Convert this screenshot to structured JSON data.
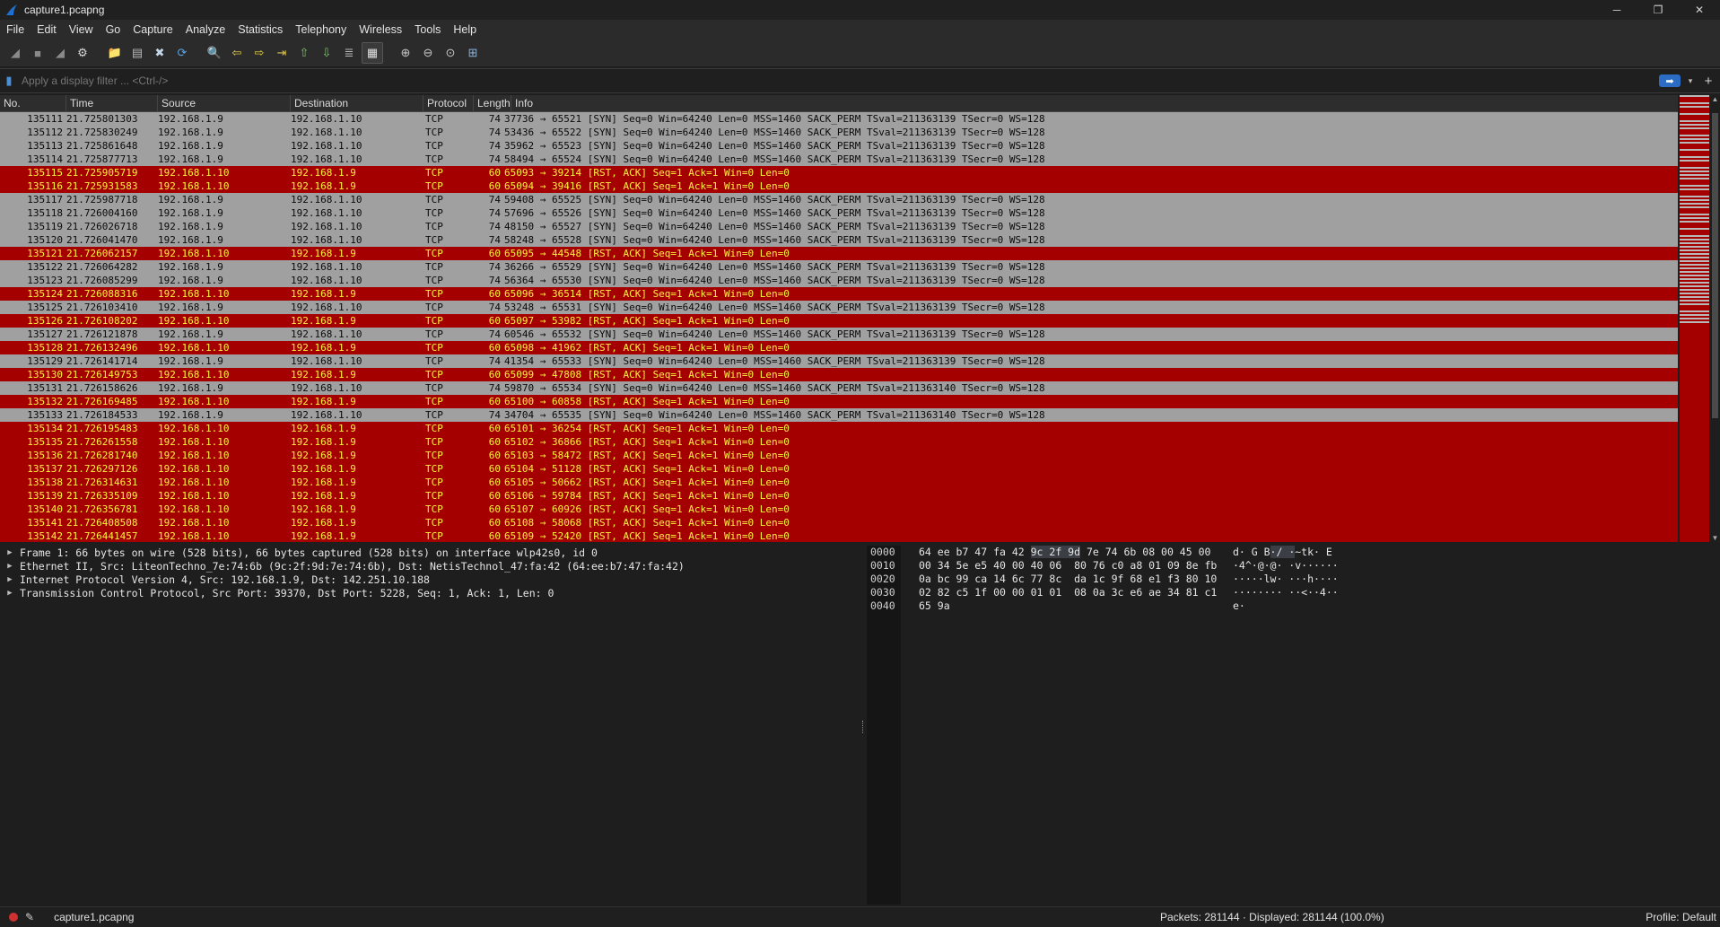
{
  "window": {
    "title": "capture1.pcapng",
    "minimize": "─",
    "maximize": "❐",
    "close": "✕"
  },
  "menu": [
    "File",
    "Edit",
    "View",
    "Go",
    "Capture",
    "Analyze",
    "Statistics",
    "Telephony",
    "Wireless",
    "Tools",
    "Help"
  ],
  "toolbar": {
    "icons": [
      "shark-fin-start-icon",
      "stop-square-icon",
      "restart-fin-icon",
      "capture-options-gear-icon",
      "open-folder-icon",
      "save-file-icon",
      "close-file-icon",
      "reload-icon",
      "find-packet-icon",
      "go-back-arrow-icon",
      "go-forward-arrow-icon",
      "go-to-packet-icon",
      "first-packet-arrow-icon",
      "last-packet-arrow-icon",
      "auto-scroll-icon",
      "colorize-icon",
      "zoom-in-icon",
      "zoom-out-icon",
      "normal-size-icon",
      "resize-columns-icon"
    ],
    "glyphs": [
      "◢",
      "■",
      "◢",
      "⚙",
      "📁",
      "▤",
      "✖",
      "⟳",
      "🔍",
      "⇦",
      "⇨",
      "⇥",
      "⇧",
      "⇩",
      "≣",
      "▦",
      "⊕",
      "⊖",
      "⊙",
      "⊞"
    ],
    "colors": [
      "#8a8a8a",
      "#8a8a8a",
      "#8a8a8a",
      "#d8d8d8",
      "#e8b939",
      "#b8b8b8",
      "#c6d6ea",
      "#5aa3e0",
      "#c8c8c8",
      "#e8d24a",
      "#e8d24a",
      "#d8c24a",
      "#7fc06a",
      "#7fc06a",
      "#b8b8b8",
      "#e0e0e0",
      "#c8c8c8",
      "#c8c8c8",
      "#c8c8c8",
      "#8cb0d8"
    ]
  },
  "filter": {
    "placeholder": "Apply a display filter ... <Ctrl-/>",
    "apply": "➡",
    "dropdown": "▾",
    "add": "+"
  },
  "columns": [
    "No.",
    "Time",
    "Source",
    "Destination",
    "Protocol",
    "Length",
    "Info"
  ],
  "packets": [
    {
      "no": "135111",
      "time": "21.725801303",
      "src": "192.168.1.9",
      "dst": "192.168.1.10",
      "proto": "TCP",
      "len": "74",
      "info": "37736 → 65521 [SYN] Seq=0 Win=64240 Len=0 MSS=1460 SACK_PERM TSval=211363139 TSecr=0 WS=128",
      "type": "syn"
    },
    {
      "no": "135112",
      "time": "21.725830249",
      "src": "192.168.1.9",
      "dst": "192.168.1.10",
      "proto": "TCP",
      "len": "74",
      "info": "53436 → 65522 [SYN] Seq=0 Win=64240 Len=0 MSS=1460 SACK_PERM TSval=211363139 TSecr=0 WS=128",
      "type": "syn"
    },
    {
      "no": "135113",
      "time": "21.725861648",
      "src": "192.168.1.9",
      "dst": "192.168.1.10",
      "proto": "TCP",
      "len": "74",
      "info": "35962 → 65523 [SYN] Seq=0 Win=64240 Len=0 MSS=1460 SACK_PERM TSval=211363139 TSecr=0 WS=128",
      "type": "syn"
    },
    {
      "no": "135114",
      "time": "21.725877713",
      "src": "192.168.1.9",
      "dst": "192.168.1.10",
      "proto": "TCP",
      "len": "74",
      "info": "58494 → 65524 [SYN] Seq=0 Win=64240 Len=0 MSS=1460 SACK_PERM TSval=211363139 TSecr=0 WS=128",
      "type": "syn"
    },
    {
      "no": "135115",
      "time": "21.725905719",
      "src": "192.168.1.10",
      "dst": "192.168.1.9",
      "proto": "TCP",
      "len": "60",
      "info": "65093 → 39214 [RST, ACK] Seq=1 Ack=1 Win=0 Len=0",
      "type": "rst"
    },
    {
      "no": "135116",
      "time": "21.725931583",
      "src": "192.168.1.10",
      "dst": "192.168.1.9",
      "proto": "TCP",
      "len": "60",
      "info": "65094 → 39416 [RST, ACK] Seq=1 Ack=1 Win=0 Len=0",
      "type": "rst"
    },
    {
      "no": "135117",
      "time": "21.725987718",
      "src": "192.168.1.9",
      "dst": "192.168.1.10",
      "proto": "TCP",
      "len": "74",
      "info": "59408 → 65525 [SYN] Seq=0 Win=64240 Len=0 MSS=1460 SACK_PERM TSval=211363139 TSecr=0 WS=128",
      "type": "syn"
    },
    {
      "no": "135118",
      "time": "21.726004160",
      "src": "192.168.1.9",
      "dst": "192.168.1.10",
      "proto": "TCP",
      "len": "74",
      "info": "57696 → 65526 [SYN] Seq=0 Win=64240 Len=0 MSS=1460 SACK_PERM TSval=211363139 TSecr=0 WS=128",
      "type": "syn"
    },
    {
      "no": "135119",
      "time": "21.726026718",
      "src": "192.168.1.9",
      "dst": "192.168.1.10",
      "proto": "TCP",
      "len": "74",
      "info": "48150 → 65527 [SYN] Seq=0 Win=64240 Len=0 MSS=1460 SACK_PERM TSval=211363139 TSecr=0 WS=128",
      "type": "syn"
    },
    {
      "no": "135120",
      "time": "21.726041470",
      "src": "192.168.1.9",
      "dst": "192.168.1.10",
      "proto": "TCP",
      "len": "74",
      "info": "58248 → 65528 [SYN] Seq=0 Win=64240 Len=0 MSS=1460 SACK_PERM TSval=211363139 TSecr=0 WS=128",
      "type": "syn"
    },
    {
      "no": "135121",
      "time": "21.726062157",
      "src": "192.168.1.10",
      "dst": "192.168.1.9",
      "proto": "TCP",
      "len": "60",
      "info": "65095 → 44548 [RST, ACK] Seq=1 Ack=1 Win=0 Len=0",
      "type": "rst"
    },
    {
      "no": "135122",
      "time": "21.726064282",
      "src": "192.168.1.9",
      "dst": "192.168.1.10",
      "proto": "TCP",
      "len": "74",
      "info": "36266 → 65529 [SYN] Seq=0 Win=64240 Len=0 MSS=1460 SACK_PERM TSval=211363139 TSecr=0 WS=128",
      "type": "syn"
    },
    {
      "no": "135123",
      "time": "21.726085299",
      "src": "192.168.1.9",
      "dst": "192.168.1.10",
      "proto": "TCP",
      "len": "74",
      "info": "56364 → 65530 [SYN] Seq=0 Win=64240 Len=0 MSS=1460 SACK_PERM TSval=211363139 TSecr=0 WS=128",
      "type": "syn"
    },
    {
      "no": "135124",
      "time": "21.726088316",
      "src": "192.168.1.10",
      "dst": "192.168.1.9",
      "proto": "TCP",
      "len": "60",
      "info": "65096 → 36514 [RST, ACK] Seq=1 Ack=1 Win=0 Len=0",
      "type": "rst"
    },
    {
      "no": "135125",
      "time": "21.726103410",
      "src": "192.168.1.9",
      "dst": "192.168.1.10",
      "proto": "TCP",
      "len": "74",
      "info": "53248 → 65531 [SYN] Seq=0 Win=64240 Len=0 MSS=1460 SACK_PERM TSval=211363139 TSecr=0 WS=128",
      "type": "syn"
    },
    {
      "no": "135126",
      "time": "21.726108202",
      "src": "192.168.1.10",
      "dst": "192.168.1.9",
      "proto": "TCP",
      "len": "60",
      "info": "65097 → 53982 [RST, ACK] Seq=1 Ack=1 Win=0 Len=0",
      "type": "rst"
    },
    {
      "no": "135127",
      "time": "21.726121878",
      "src": "192.168.1.9",
      "dst": "192.168.1.10",
      "proto": "TCP",
      "len": "74",
      "info": "60546 → 65532 [SYN] Seq=0 Win=64240 Len=0 MSS=1460 SACK_PERM TSval=211363139 TSecr=0 WS=128",
      "type": "syn"
    },
    {
      "no": "135128",
      "time": "21.726132496",
      "src": "192.168.1.10",
      "dst": "192.168.1.9",
      "proto": "TCP",
      "len": "60",
      "info": "65098 → 41962 [RST, ACK] Seq=1 Ack=1 Win=0 Len=0",
      "type": "rst"
    },
    {
      "no": "135129",
      "time": "21.726141714",
      "src": "192.168.1.9",
      "dst": "192.168.1.10",
      "proto": "TCP",
      "len": "74",
      "info": "41354 → 65533 [SYN] Seq=0 Win=64240 Len=0 MSS=1460 SACK_PERM TSval=211363139 TSecr=0 WS=128",
      "type": "syn"
    },
    {
      "no": "135130",
      "time": "21.726149753",
      "src": "192.168.1.10",
      "dst": "192.168.1.9",
      "proto": "TCP",
      "len": "60",
      "info": "65099 → 47808 [RST, ACK] Seq=1 Ack=1 Win=0 Len=0",
      "type": "rst"
    },
    {
      "no": "135131",
      "time": "21.726158626",
      "src": "192.168.1.9",
      "dst": "192.168.1.10",
      "proto": "TCP",
      "len": "74",
      "info": "59870 → 65534 [SYN] Seq=0 Win=64240 Len=0 MSS=1460 SACK_PERM TSval=211363140 TSecr=0 WS=128",
      "type": "syn"
    },
    {
      "no": "135132",
      "time": "21.726169485",
      "src": "192.168.1.10",
      "dst": "192.168.1.9",
      "proto": "TCP",
      "len": "60",
      "info": "65100 → 60858 [RST, ACK] Seq=1 Ack=1 Win=0 Len=0",
      "type": "rst"
    },
    {
      "no": "135133",
      "time": "21.726184533",
      "src": "192.168.1.9",
      "dst": "192.168.1.10",
      "proto": "TCP",
      "len": "74",
      "info": "34704 → 65535 [SYN] Seq=0 Win=64240 Len=0 MSS=1460 SACK_PERM TSval=211363140 TSecr=0 WS=128",
      "type": "syn"
    },
    {
      "no": "135134",
      "time": "21.726195483",
      "src": "192.168.1.10",
      "dst": "192.168.1.9",
      "proto": "TCP",
      "len": "60",
      "info": "65101 → 36254 [RST, ACK] Seq=1 Ack=1 Win=0 Len=0",
      "type": "rst"
    },
    {
      "no": "135135",
      "time": "21.726261558",
      "src": "192.168.1.10",
      "dst": "192.168.1.9",
      "proto": "TCP",
      "len": "60",
      "info": "65102 → 36866 [RST, ACK] Seq=1 Ack=1 Win=0 Len=0",
      "type": "rst"
    },
    {
      "no": "135136",
      "time": "21.726281740",
      "src": "192.168.1.10",
      "dst": "192.168.1.9",
      "proto": "TCP",
      "len": "60",
      "info": "65103 → 58472 [RST, ACK] Seq=1 Ack=1 Win=0 Len=0",
      "type": "rst"
    },
    {
      "no": "135137",
      "time": "21.726297126",
      "src": "192.168.1.10",
      "dst": "192.168.1.9",
      "proto": "TCP",
      "len": "60",
      "info": "65104 → 51128 [RST, ACK] Seq=1 Ack=1 Win=0 Len=0",
      "type": "rst"
    },
    {
      "no": "135138",
      "time": "21.726314631",
      "src": "192.168.1.10",
      "dst": "192.168.1.9",
      "proto": "TCP",
      "len": "60",
      "info": "65105 → 50662 [RST, ACK] Seq=1 Ack=1 Win=0 Len=0",
      "type": "rst"
    },
    {
      "no": "135139",
      "time": "21.726335109",
      "src": "192.168.1.10",
      "dst": "192.168.1.9",
      "proto": "TCP",
      "len": "60",
      "info": "65106 → 59784 [RST, ACK] Seq=1 Ack=1 Win=0 Len=0",
      "type": "rst"
    },
    {
      "no": "135140",
      "time": "21.726356781",
      "src": "192.168.1.10",
      "dst": "192.168.1.9",
      "proto": "TCP",
      "len": "60",
      "info": "65107 → 60926 [RST, ACK] Seq=1 Ack=1 Win=0 Len=0",
      "type": "rst"
    },
    {
      "no": "135141",
      "time": "21.726408508",
      "src": "192.168.1.10",
      "dst": "192.168.1.9",
      "proto": "TCP",
      "len": "60",
      "info": "65108 → 58068 [RST, ACK] Seq=1 Ack=1 Win=0 Len=0",
      "type": "rst"
    },
    {
      "no": "135142",
      "time": "21.726441457",
      "src": "192.168.1.10",
      "dst": "192.168.1.9",
      "proto": "TCP",
      "len": "60",
      "info": "65109 → 52420 [RST, ACK] Seq=1 Ack=1 Win=0 Len=0",
      "type": "rst"
    }
  ],
  "details": [
    "Frame 1: 66 bytes on wire (528 bits), 66 bytes captured (528 bits) on interface wlp42s0, id 0",
    "Ethernet II, Src: LiteonTechno_7e:74:6b (9c:2f:9d:7e:74:6b), Dst: NetisTechnol_47:fa:42 (64:ee:b7:47:fa:42)",
    "Internet Protocol Version 4, Src: 192.168.1.9, Dst: 142.251.10.188",
    "Transmission Control Protocol, Src Port: 39370, Dst Port: 5228, Seq: 1, Ack: 1, Len: 0"
  ],
  "details_expander": "▶",
  "hex": [
    {
      "off": "0000",
      "bytes": [
        "64 ee b7 47 fa 42 ",
        "9c 2f ",
        "9d",
        " 7e 74 6b 08 00 45 00"
      ],
      "ascii": [
        "d· G B",
        "·/ ·",
        "~tk· E"
      ]
    },
    {
      "off": "0010",
      "bytes": [
        "00 34 5e e5 40 00 40 06  80 76 c0 a8 01 09 8e fb"
      ],
      "ascii": [
        "·4^·@·@· ·v······"
      ]
    },
    {
      "off": "0020",
      "bytes": [
        "0a bc 99 ca 14 6c 77 8c  da 1c 9f 68 e1 f3 80 10"
      ],
      "ascii": [
        "·····lw· ···h····"
      ]
    },
    {
      "off": "0030",
      "bytes": [
        "02 82 c5 1f 00 00 01 01  08 0a 3c e6 ae 34 81 c1"
      ],
      "ascii": [
        "········ ··<··4··"
      ]
    },
    {
      "off": "0040",
      "bytes": [
        "65 9a"
      ],
      "ascii": [
        "e·"
      ]
    }
  ],
  "status": {
    "file": "capture1.pcapng",
    "packets": "Packets: 281144 · Displayed: 281144 (100.0%)",
    "profile": "Profile: Default"
  },
  "colors": {
    "syn_row": "#a0a0a0",
    "rst_row": "#a40000",
    "rst_text": "#fff23d"
  },
  "minimap_pattern": [
    1,
    0,
    1,
    1,
    0,
    1,
    0,
    1,
    1,
    1,
    0,
    1,
    1,
    1,
    0,
    1,
    0,
    1,
    1,
    0,
    1,
    1,
    1,
    1,
    0,
    1,
    1,
    0,
    1,
    1,
    1,
    1,
    0,
    1,
    1,
    1,
    0,
    1,
    0,
    1,
    1,
    1,
    1,
    1,
    1,
    1,
    1,
    1,
    1,
    1,
    1,
    1,
    1,
    1,
    1,
    1,
    1,
    1,
    1,
    0,
    1,
    1,
    1,
    1
  ]
}
